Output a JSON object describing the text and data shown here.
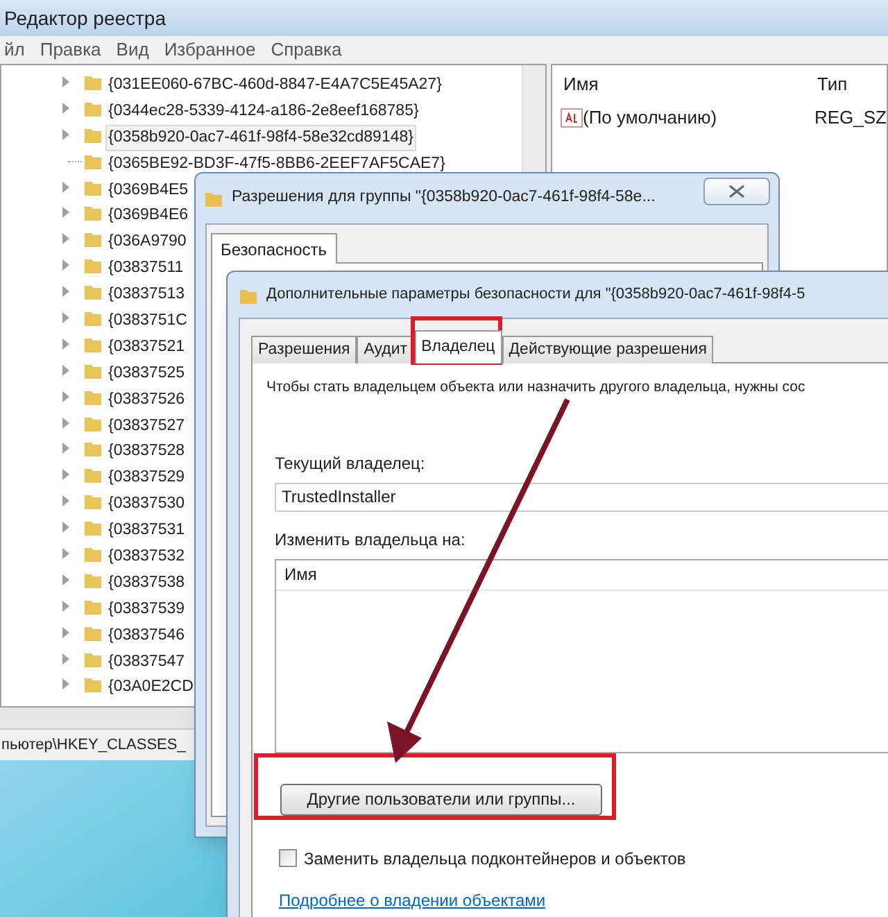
{
  "registry_editor": {
    "title": "Редактор реестра",
    "menu": [
      "йл",
      "Правка",
      "Вид",
      "Избранное",
      "Справка"
    ],
    "tree": [
      {
        "label": "{031EE060-67BC-460d-8847-E4A7C5E45A27}",
        "selected": false,
        "expandable": true
      },
      {
        "label": "{0344ec28-5339-4124-a186-2e8eef168785}",
        "selected": false,
        "expandable": true
      },
      {
        "label": "{0358b920-0ac7-461f-98f4-58e32cd89148}",
        "selected": true,
        "expandable": true
      },
      {
        "label": "{0365BE92-BD3F-47f5-8BB6-2EEF7AF5CAE7}",
        "selected": false,
        "expandable": false
      },
      {
        "label": "{0369B4E5",
        "selected": false,
        "expandable": true
      },
      {
        "label": "{0369B4E6",
        "selected": false,
        "expandable": true
      },
      {
        "label": "{036A9790",
        "selected": false,
        "expandable": true
      },
      {
        "label": "{03837511",
        "selected": false,
        "expandable": true
      },
      {
        "label": "{03837513",
        "selected": false,
        "expandable": true
      },
      {
        "label": "{0383751C",
        "selected": false,
        "expandable": true
      },
      {
        "label": "{03837521",
        "selected": false,
        "expandable": true
      },
      {
        "label": "{03837525",
        "selected": false,
        "expandable": true
      },
      {
        "label": "{03837526",
        "selected": false,
        "expandable": true
      },
      {
        "label": "{03837527",
        "selected": false,
        "expandable": true
      },
      {
        "label": "{03837528",
        "selected": false,
        "expandable": true
      },
      {
        "label": "{03837529",
        "selected": false,
        "expandable": true
      },
      {
        "label": "{03837530",
        "selected": false,
        "expandable": true
      },
      {
        "label": "{03837531",
        "selected": false,
        "expandable": true
      },
      {
        "label": "{03837532",
        "selected": false,
        "expandable": true
      },
      {
        "label": "{03837538",
        "selected": false,
        "expandable": true
      },
      {
        "label": "{03837539",
        "selected": false,
        "expandable": true
      },
      {
        "label": "{03837546",
        "selected": false,
        "expandable": true
      },
      {
        "label": "{03837547",
        "selected": false,
        "expandable": true
      },
      {
        "label": "{03A0E2CD",
        "selected": false,
        "expandable": true
      }
    ],
    "values": {
      "columns": [
        "Имя",
        "Тип"
      ],
      "rows": [
        {
          "name": "(По умолчанию)",
          "type": "REG_SZ"
        }
      ]
    },
    "status_bar": "пьютер\\HKEY_CLASSES_"
  },
  "permissions_dialog": {
    "title": "Разрешения для группы \"{0358b920-0ac7-461f-98f4-58e...",
    "tabs": [
      {
        "label": "Безопасность",
        "selected": true
      }
    ]
  },
  "advanced_dialog": {
    "title": "Дополнительные параметры безопасности  для \"{0358b920-0ac7-461f-98f4-5",
    "tabs": [
      {
        "label": "Разрешения",
        "selected": false
      },
      {
        "label": "Аудит",
        "selected": false
      },
      {
        "label": "Владелец",
        "selected": true
      },
      {
        "label": "Действующие разрешения",
        "selected": false
      }
    ],
    "intro": "Чтобы стать владельцем объекта или назначить другого владельца, нужны сос",
    "current_owner_label": "Текущий владелец:",
    "current_owner": "TrustedInstaller",
    "change_owner_label": "Изменить владельца на:",
    "owner_list": {
      "columns": [
        "Имя"
      ]
    },
    "other_users_button": "Другие пользователи или группы...",
    "replace_owner": {
      "label": "Заменить владельца подконтейнеров и объектов",
      "checked": false
    },
    "link": "Подробнее о владении объектами"
  }
}
